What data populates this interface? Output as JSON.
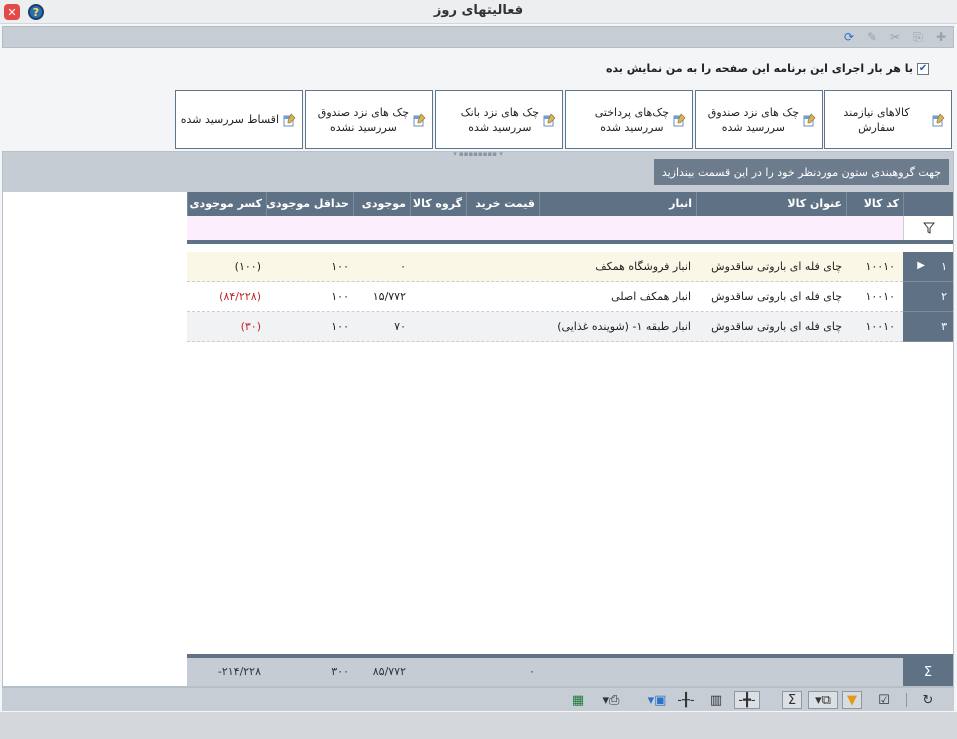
{
  "window": {
    "title": "فعالیتهای روز"
  },
  "colors": {
    "header_bg": "#5f7285",
    "group_bar": "#c5ccd4",
    "filter_row": "#fdeefd",
    "selected_row": "#fbf7e7",
    "negative": "#c0282d",
    "tile_border": "#5e7590"
  },
  "toolbar": {
    "icons": [
      "new-icon",
      "duplicate-icon",
      "delete-icon",
      "edit-icon",
      "refresh-sync-icon"
    ]
  },
  "startup_checkbox": {
    "label": "با هر بار اجرای این برنامه این صفحه را به من نمایش بده",
    "checked": true
  },
  "tiles": [
    {
      "label": "کالاهای نیازمند سفارش"
    },
    {
      "label": "چک های نزد صندوق\nسررسید شده"
    },
    {
      "label": "چک‌های پرداختی\nسررسید شده"
    },
    {
      "label": "چک های نزد بانک\nسررسید شده"
    },
    {
      "label": "چک های نزد صندوق\nسررسید نشده"
    },
    {
      "label": "اقساط سررسید شده"
    }
  ],
  "grid": {
    "group_hint": "جهت گروهبندی ستون موردنظر خود را در این قسمت بیندازید",
    "columns": [
      "کد کالا",
      "عنوان کالا",
      "انبار",
      "قیمت خرید",
      "گروه کالا",
      "موجودی",
      "حداقل موجودی",
      "کسر موجودی"
    ],
    "rows": [
      {
        "num": "۱",
        "code": "۱۰۰۱۰",
        "title": "چای فله ای باروتی ساقدوش",
        "warehouse": "انبار فروشگاه همکف",
        "price": "",
        "group": "",
        "stock": "۰",
        "min_stock": "۱۰۰",
        "shortage": "(۱۰۰)",
        "shortage_color": "dark"
      },
      {
        "num": "۲",
        "code": "۱۰۰۱۰",
        "title": "چای فله ای باروتی ساقدوش",
        "warehouse": "انبار همکف اصلی",
        "price": "",
        "group": "",
        "stock": "۱۵/۷۷۲",
        "min_stock": "۱۰۰",
        "shortage": "(۸۴/۲۲۸)",
        "shortage_color": "red"
      },
      {
        "num": "۳",
        "code": "۱۰۰۱۰",
        "title": "چای فله ای باروتی ساقدوش",
        "warehouse": "انبار طبقه ۱- (شوینده غذایی)",
        "price": "",
        "group": "",
        "stock": "۷۰",
        "min_stock": "۱۰۰",
        "shortage": "(۳۰)",
        "shortage_color": "red"
      }
    ],
    "summary": {
      "symbol": "Σ",
      "price": "۰",
      "stock": "۸۵/۷۷۲",
      "min_stock": "۳۰۰",
      "shortage": "۲۱۴/۲۲۸-"
    }
  },
  "bottom_toolbar": {
    "icons": [
      "refresh-icon",
      "checklist-icon",
      "filter-icon",
      "column-chooser-icon",
      "sum-icon",
      "fit-width-icon",
      "columns-icon",
      "fit-icon",
      "save-icon",
      "print-icon",
      "export-excel-icon"
    ]
  }
}
